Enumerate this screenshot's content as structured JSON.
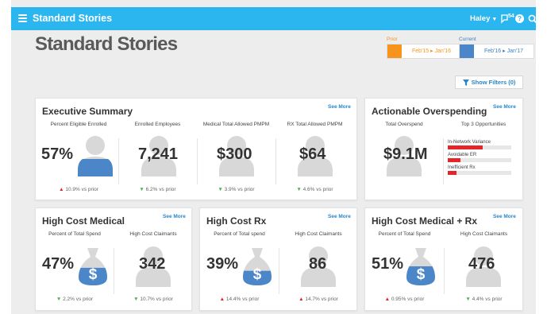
{
  "app": {
    "title": "Standard Stories",
    "user": "Haley",
    "notification_count": "54"
  },
  "page": {
    "title": "Standard Stories"
  },
  "periods": {
    "prior": {
      "label": "Prior",
      "range": "Feb'15 ▸ Jan'16",
      "color": "#f7941d"
    },
    "current": {
      "label": "Current",
      "range": "Feb'16 ▸ Jan'17",
      "color": "#4a86c8"
    }
  },
  "filters": {
    "label": "Show Filters (0)"
  },
  "see_more": "See More",
  "executive_summary": {
    "title": "Executive Summary",
    "metrics": [
      {
        "label": "Percent Eligible Enrolled",
        "value": "57%",
        "direction": "up",
        "change": "10.9%",
        "suffix": "vs prior"
      },
      {
        "label": "Enrolled Employees",
        "value": "7,241",
        "direction": "down",
        "change": "6.2%",
        "suffix": "vs prior"
      },
      {
        "label": "Medical Total Allowed PMPM",
        "value": "$300",
        "direction": "down",
        "change": "3.9%",
        "suffix": "vs prior"
      },
      {
        "label": "RX Total Allowed PMPM",
        "value": "$64",
        "direction": "down",
        "change": "4.6%",
        "suffix": "vs prior"
      }
    ]
  },
  "actionable_overspending": {
    "title": "Actionable Overspending",
    "total": {
      "label": "Total Overspend",
      "value": "$9.1M"
    },
    "opportunities": {
      "label": "Top 3 Opportunities",
      "items": [
        {
          "label": "In-Network Variance",
          "fill": 0.55
        },
        {
          "label": "Avoidable ER",
          "fill": 0.2
        },
        {
          "label": "Inefficient Rx",
          "fill": 0.14
        }
      ]
    }
  },
  "high_cost_medical": {
    "title": "High Cost Medical",
    "spend": {
      "label": "Percent of Total Spend",
      "value": "47%",
      "direction": "down",
      "change": "2.2%",
      "suffix": "vs prior",
      "fill": 0.47
    },
    "claimants": {
      "label": "High Cost Claimants",
      "value": "342",
      "direction": "down",
      "change": "10.7%",
      "suffix": "vs prior"
    }
  },
  "high_cost_rx": {
    "title": "High Cost Rx",
    "spend": {
      "label": "Percent of Total spend",
      "value": "39%",
      "direction": "up",
      "change": "14.4%",
      "suffix": "vs prior",
      "fill": 0.39
    },
    "claimants": {
      "label": "High Cost Claimants",
      "value": "86",
      "direction": "up",
      "change": "14.7%",
      "suffix": "vs prior"
    }
  },
  "high_cost_medical_rx": {
    "title": "High Cost Medical + Rx",
    "spend": {
      "label": "Percent of Total Spend",
      "value": "51%",
      "direction": "up",
      "change": "0.95%",
      "suffix": "vs prior",
      "fill": 0.51
    },
    "claimants": {
      "label": "High Cost Claimants",
      "value": "476",
      "direction": "down",
      "change": "4.4%",
      "suffix": "vs prior"
    }
  }
}
